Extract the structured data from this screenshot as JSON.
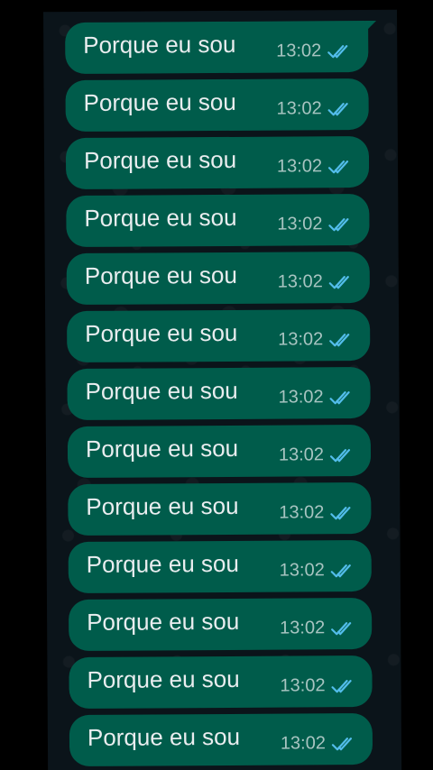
{
  "chat": {
    "colors": {
      "background": "#0b141a",
      "bubble": "#005c4b",
      "text": "#e9edef",
      "read_tick": "#53bdeb"
    },
    "messages": [
      {
        "text": "Porque eu sou",
        "time": "13:02",
        "status_icon": "double-check-read-icon"
      },
      {
        "text": "Porque eu sou",
        "time": "13:02",
        "status_icon": "double-check-read-icon"
      },
      {
        "text": "Porque eu sou",
        "time": "13:02",
        "status_icon": "double-check-read-icon"
      },
      {
        "text": "Porque eu sou",
        "time": "13:02",
        "status_icon": "double-check-read-icon"
      },
      {
        "text": "Porque eu sou",
        "time": "13:02",
        "status_icon": "double-check-read-icon"
      },
      {
        "text": "Porque eu sou",
        "time": "13:02",
        "status_icon": "double-check-read-icon"
      },
      {
        "text": "Porque eu sou",
        "time": "13:02",
        "status_icon": "double-check-read-icon"
      },
      {
        "text": "Porque eu sou",
        "time": "13:02",
        "status_icon": "double-check-read-icon"
      },
      {
        "text": "Porque eu sou",
        "time": "13:02",
        "status_icon": "double-check-read-icon"
      },
      {
        "text": "Porque eu sou",
        "time": "13:02",
        "status_icon": "double-check-read-icon"
      },
      {
        "text": "Porque eu sou",
        "time": "13:02",
        "status_icon": "double-check-read-icon"
      },
      {
        "text": "Porque eu sou",
        "time": "13:02",
        "status_icon": "double-check-read-icon"
      },
      {
        "text": "Porque eu sou",
        "time": "13:02",
        "status_icon": "double-check-read-icon"
      }
    ]
  }
}
